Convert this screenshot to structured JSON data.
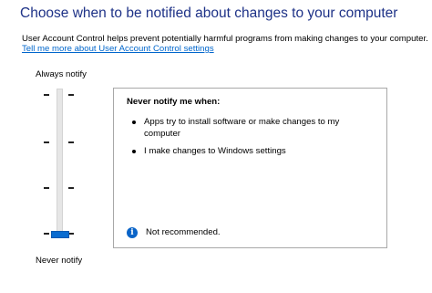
{
  "header": {
    "title": "Choose when to be notified about changes to your computer",
    "description": "User Account Control helps prevent potentially harmful programs from making changes to your computer.",
    "learn_more_link": "Tell me more about User Account Control settings"
  },
  "slider": {
    "top_label": "Always notify",
    "bottom_label": "Never notify",
    "levels": 4,
    "selected_level": 1,
    "thumb_color": "#0a6cd0"
  },
  "panel": {
    "heading": "Never notify me when:",
    "bullets": [
      "Apps try to install software or make changes to my computer",
      "I make changes to Windows settings"
    ],
    "note": "Not recommended.",
    "note_icon": "info-icon",
    "info_color": "#0a64c8"
  },
  "colors": {
    "title": "#1e3287",
    "link": "#0066cc"
  }
}
